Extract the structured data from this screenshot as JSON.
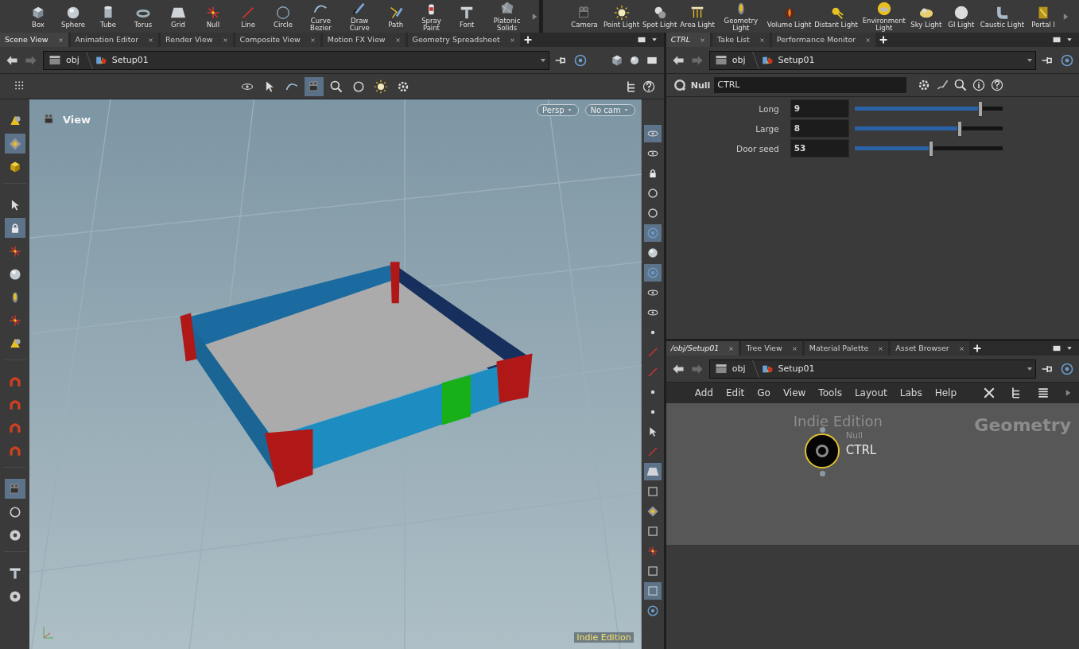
{
  "shelf_left": [
    {
      "label": "Box"
    },
    {
      "label": "Sphere"
    },
    {
      "label": "Tube"
    },
    {
      "label": "Torus"
    },
    {
      "label": "Grid"
    },
    {
      "label": "Null"
    },
    {
      "label": "Line"
    },
    {
      "label": "Circle"
    },
    {
      "label": "Curve Bezier"
    },
    {
      "label": "Draw Curve"
    },
    {
      "label": "Path"
    },
    {
      "label": "Spray Paint"
    },
    {
      "label": "Font"
    },
    {
      "label": "Platonic Solids"
    }
  ],
  "shelf_right": [
    {
      "label": "Camera"
    },
    {
      "label": "Point Light"
    },
    {
      "label": "Spot Light"
    },
    {
      "label": "Area Light"
    },
    {
      "label": "Geometry Light"
    },
    {
      "label": "Volume Light"
    },
    {
      "label": "Distant Light"
    },
    {
      "label": "Environment Light"
    },
    {
      "label": "Sky Light"
    },
    {
      "label": "GI Light"
    },
    {
      "label": "Caustic Light"
    },
    {
      "label": "Portal l"
    }
  ],
  "scene_pane": {
    "tabs": [
      {
        "label": "Scene View",
        "selected": true
      },
      {
        "label": "Animation Editor",
        "selected": false
      },
      {
        "label": "Render View",
        "selected": false
      },
      {
        "label": "Composite View",
        "selected": false
      },
      {
        "label": "Motion FX View",
        "selected": false
      },
      {
        "label": "Geometry Spreadsheet",
        "selected": false
      }
    ],
    "path": [
      "obj",
      "Setup01"
    ],
    "viewport": {
      "title": "View",
      "camera_buttons": [
        "Persp",
        "No cam"
      ],
      "watermark": "Indie Edition"
    },
    "left_tools": [
      {
        "selected": false
      },
      {
        "selected": true
      },
      {
        "selected": false
      },
      {
        "selected": false
      },
      {
        "selected": true
      },
      {
        "selected": false
      },
      {
        "selected": false
      },
      {
        "selected": false
      },
      {
        "selected": false
      },
      {
        "selected": false
      },
      {
        "selected": false
      },
      {
        "selected": false
      },
      {
        "selected": false
      },
      {
        "selected": false
      },
      {
        "selected": true
      },
      {
        "selected": false
      },
      {
        "selected": false
      },
      {
        "selected": false
      },
      {
        "selected": false
      }
    ],
    "right_tools": [
      {
        "selected": true
      },
      {
        "selected": false
      },
      {
        "selected": false
      },
      {
        "selected": false
      },
      {
        "selected": false
      },
      {
        "selected": true
      },
      {
        "selected": false
      },
      {
        "selected": true
      },
      {
        "selected": false
      },
      {
        "selected": false
      },
      {
        "selected": false
      },
      {
        "selected": false
      },
      {
        "selected": false
      },
      {
        "selected": false
      },
      {
        "selected": false
      },
      {
        "selected": false
      },
      {
        "selected": false
      },
      {
        "selected": true
      },
      {
        "selected": false
      },
      {
        "selected": false
      },
      {
        "selected": false
      },
      {
        "selected": false
      },
      {
        "selected": false
      },
      {
        "selected": true
      },
      {
        "selected": false
      }
    ]
  },
  "param_pane": {
    "tabs": [
      {
        "label": "CTRL",
        "selected": true
      },
      {
        "label": "Take List",
        "selected": false
      },
      {
        "label": "Performance Monitor",
        "selected": false
      }
    ],
    "path": [
      "obj",
      "Setup01"
    ],
    "node_type": "Null",
    "node_name": "CTRL",
    "parameters": [
      {
        "label": "Long",
        "value": "9",
        "level": 0.85
      },
      {
        "label": "Large",
        "value": "8",
        "level": 0.71
      },
      {
        "label": "Door seed",
        "value": "53",
        "level": 0.52
      }
    ]
  },
  "network_pane": {
    "tabs": [
      {
        "label": "/obj/Setup01",
        "selected": true
      },
      {
        "label": "Tree View",
        "selected": false
      },
      {
        "label": "Material Palette",
        "selected": false
      },
      {
        "label": "Asset Browser",
        "selected": false
      }
    ],
    "path": [
      "obj",
      "Setup01"
    ],
    "menu": [
      "Add",
      "Edit",
      "Go",
      "View",
      "Tools",
      "Layout",
      "Labs",
      "Help"
    ],
    "watermark": "Indie Edition",
    "context": "Geometry",
    "node": {
      "type": "Null",
      "name": "CTRL",
      "selected": true
    }
  }
}
